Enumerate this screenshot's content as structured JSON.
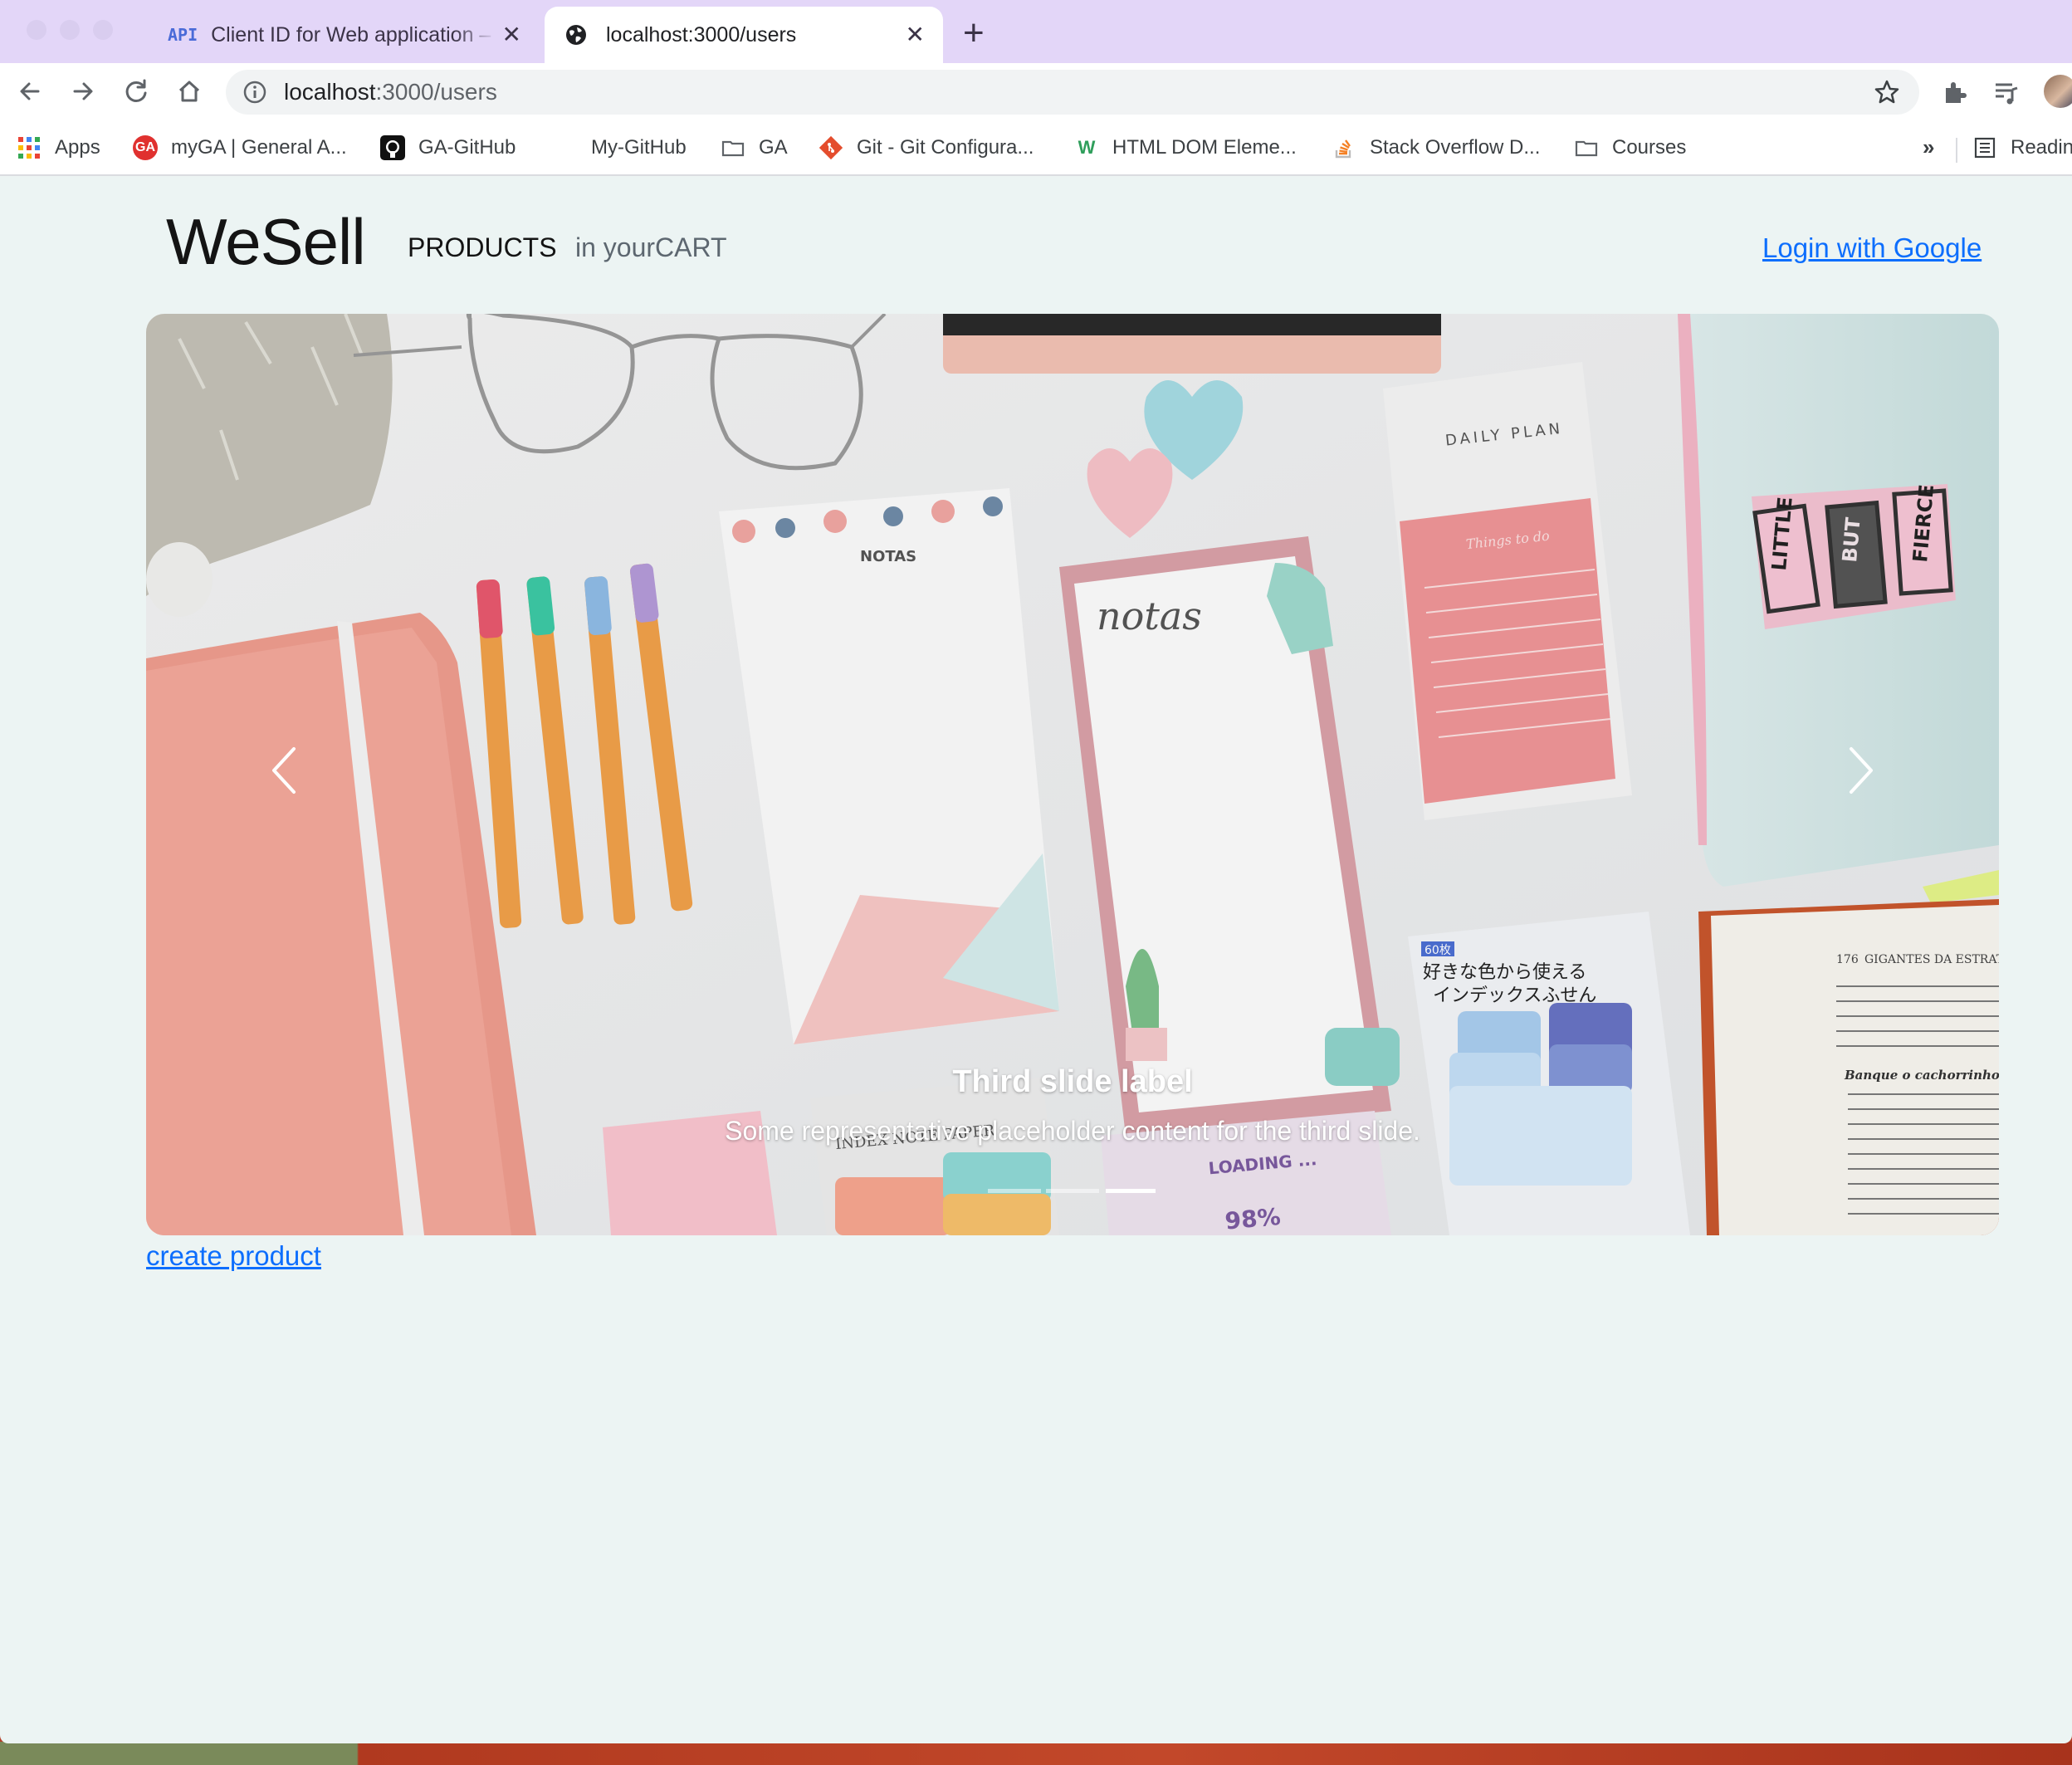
{
  "browser": {
    "tabs": [
      {
        "favicon": "API",
        "title": "Client ID for Web application –",
        "active": false
      },
      {
        "favicon": "globe-icon",
        "title": "localhost:3000/users",
        "active": true
      }
    ],
    "address": {
      "host": "localhost",
      "path": ":3000/users"
    },
    "bookmarks": [
      {
        "label": "Apps",
        "icon": "apps-grid-icon"
      },
      {
        "label": "myGA | General A...",
        "icon": "ga-icon"
      },
      {
        "label": "GA-GitHub",
        "icon": "github-icon"
      },
      {
        "label": "My-GitHub",
        "icon": "none"
      },
      {
        "label": "GA",
        "icon": "folder-icon"
      },
      {
        "label": "Git - Git Configura...",
        "icon": "git-icon"
      },
      {
        "label": "HTML DOM Eleme...",
        "icon": "w3-icon"
      },
      {
        "label": "Stack Overflow D...",
        "icon": "stackoverflow-icon"
      },
      {
        "label": "Courses",
        "icon": "folder-icon"
      },
      {
        "label": "Readin",
        "icon": "reading-list-icon"
      }
    ],
    "bookmarks_more": "»"
  },
  "navbar": {
    "brand": "WeSell",
    "links": [
      "PRODUCTS",
      "in yourCART"
    ],
    "login": "Login with Google"
  },
  "carousel": {
    "caption_title": "Third slide label",
    "caption_text": "Some representative placeholder content for the third slide.",
    "active_index": 2,
    "slide_count": 3,
    "image_text": {
      "pad1": "NOTAS",
      "pad2": "notas",
      "daily": "DAILY PLAN",
      "todo": "Things to do",
      "pouch": [
        "LITTLE",
        "BUT",
        "FIERCE"
      ],
      "tabs_count": "60枚",
      "tabs_jp1": "好きな色から使える",
      "tabs_jp2": "インデックスふせん",
      "loading": "LOADING ...",
      "percent": "98%",
      "index_paper": "INDEX NOTE PAPER",
      "book_header": "GIGANTES DA ESTRAT",
      "book_page": "176",
      "book_subhead": "Banque o cachorrinho"
    }
  },
  "footer_link": "create product",
  "colors": {
    "page_bg": "#ecf4f3",
    "link": "#0d6efd",
    "tabstrip": "#e3d6f8"
  }
}
